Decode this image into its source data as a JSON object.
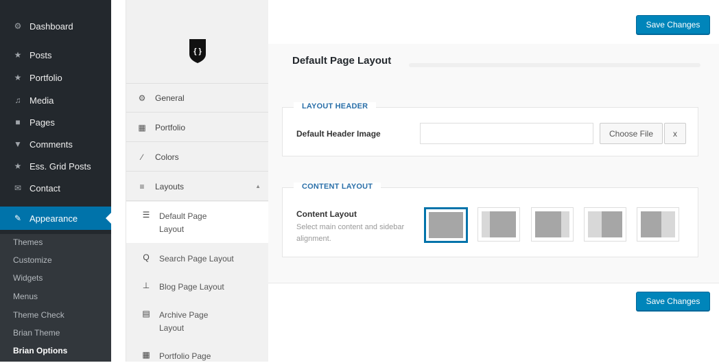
{
  "wp_menu": {
    "items": [
      {
        "label": "Dashboard",
        "icon": "dashboard-icon",
        "glyph": "⚙"
      },
      {
        "label": "Posts",
        "icon": "pin-icon",
        "glyph": "★"
      },
      {
        "label": "Portfolio",
        "icon": "pin-icon",
        "glyph": "★"
      },
      {
        "label": "Media",
        "icon": "media-icon",
        "glyph": "♫"
      },
      {
        "label": "Pages",
        "icon": "page-icon",
        "glyph": "■"
      },
      {
        "label": "Comments",
        "icon": "comment-icon",
        "glyph": "▼"
      },
      {
        "label": "Ess. Grid Posts",
        "icon": "pin-icon",
        "glyph": "★"
      },
      {
        "label": "Contact",
        "icon": "mail-icon",
        "glyph": "✉"
      },
      {
        "label": "Appearance",
        "icon": "brush-icon",
        "glyph": "✎"
      }
    ],
    "submenu": [
      "Themes",
      "Customize",
      "Widgets",
      "Menus",
      "Theme Check",
      "Brian Theme",
      "Brian Options"
    ]
  },
  "options_nav": {
    "logo_text": "{ }",
    "items": [
      {
        "label": "General",
        "icon": "gears-icon",
        "glyph": "⚙"
      },
      {
        "label": "Portfolio",
        "icon": "grid-icon",
        "glyph": "▦"
      },
      {
        "label": "Colors",
        "icon": "brush-icon",
        "glyph": "∕"
      },
      {
        "label": "Layouts",
        "icon": "align-icon",
        "glyph": "≡"
      }
    ],
    "sub_items": [
      {
        "label": "Default Page Layout",
        "icon": "list-icon",
        "glyph": "☰"
      },
      {
        "label": "Search Page Layout",
        "icon": "search-icon",
        "glyph": "Q"
      },
      {
        "label": "Blog Page Layout",
        "icon": "pin-icon",
        "glyph": "⊥"
      },
      {
        "label": "Archive Page Layout",
        "icon": "archive-icon",
        "glyph": "▤"
      },
      {
        "label": "Portfolio Page",
        "icon": "grid-icon",
        "glyph": "▦"
      }
    ]
  },
  "main": {
    "save_label": "Save Changes",
    "page_title": "Default Page Layout",
    "layout_header": {
      "title": "LAYOUT HEADER",
      "field_label": "Default Header Image",
      "input_value": "",
      "choose_label": "Choose File",
      "clear_label": "x"
    },
    "content_layout": {
      "title": "CONTENT LAYOUT",
      "field_label": "Content Layout",
      "description": "Select main content and sidebar alignment.",
      "options": [
        "full-width",
        "left-sidebar",
        "right-sidebar",
        "left-sidebar-alt",
        "right-sidebar-alt"
      ],
      "selected": "full-width"
    }
  },
  "colors": {
    "wp_sidebar": "#23282d",
    "wp_active": "#0073aa",
    "button_primary": "#0085ba",
    "section_title": "#2a6fa8"
  }
}
